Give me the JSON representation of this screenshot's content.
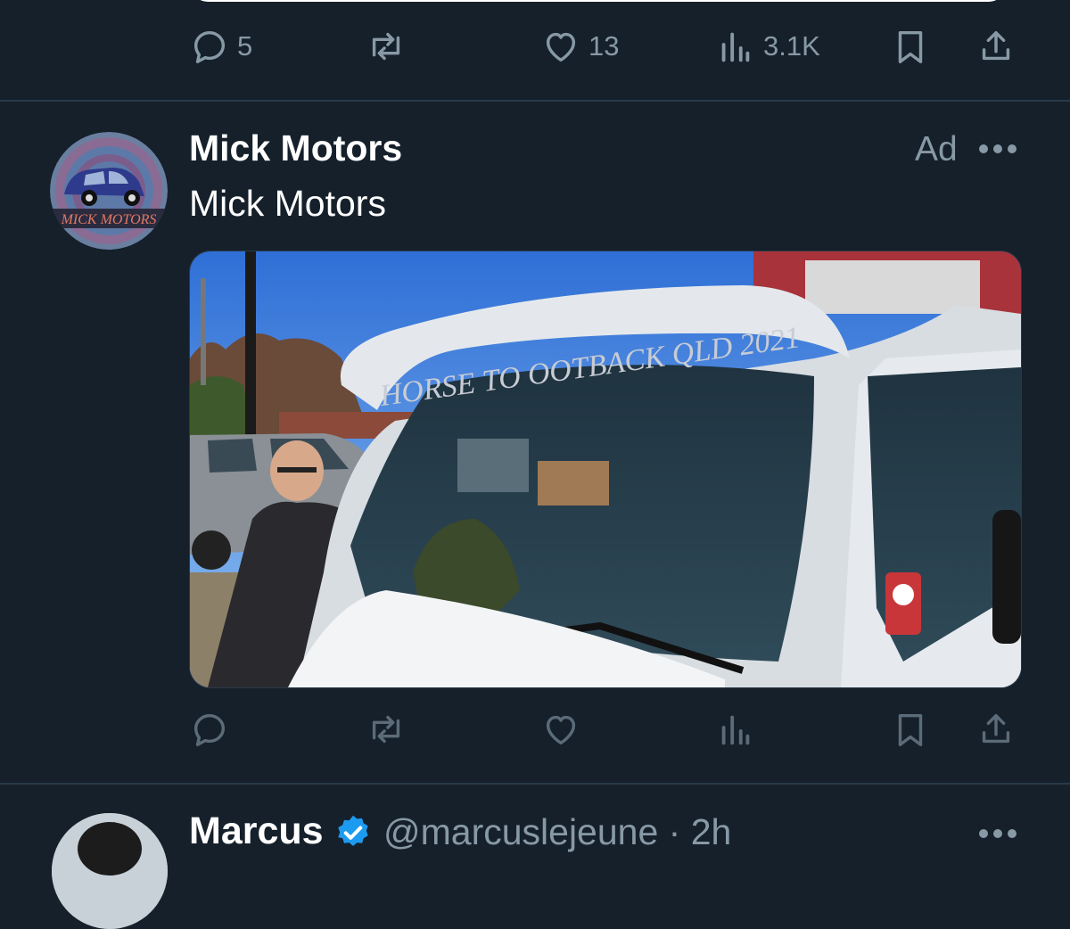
{
  "top_tweet": {
    "actions": {
      "reply_count": "5",
      "like_count": "13",
      "view_count": "3.1K"
    }
  },
  "ad_tweet": {
    "author_name": "Mick Motors",
    "avatar_text": "MICK MOTORS",
    "ad_label": "Ad",
    "text": "Mick Motors",
    "media": {
      "windscreen_text": "HORSE TO OOTBACK QLD 2021"
    }
  },
  "next_tweet": {
    "author_name": "Marcus",
    "handle_time": "@marcuslejeune · 2h"
  },
  "colors": {
    "background": "#15202b",
    "secondary_text": "#8899a6",
    "verified_blue": "#1d9bf0",
    "divider": "#2a3a49"
  },
  "icons": [
    "reply-icon",
    "retweet-icon",
    "like-icon",
    "views-icon",
    "bookmark-icon",
    "share-icon",
    "more-icon",
    "verified-badge-icon"
  ]
}
